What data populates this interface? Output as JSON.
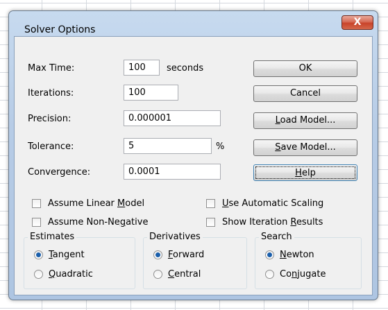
{
  "window": {
    "title": "Solver Options",
    "close_label": "X"
  },
  "fields": {
    "max_time": {
      "label": "Max Time:",
      "value": "100",
      "unit": "seconds"
    },
    "iterations": {
      "label": "Iterations:",
      "value": "100"
    },
    "precision": {
      "label": "Precision:",
      "value": "0.000001"
    },
    "tolerance": {
      "label": "Tolerance:",
      "value": "5",
      "unit": "%"
    },
    "convergence": {
      "label": "Convergence:",
      "value": "0.0001"
    }
  },
  "buttons": {
    "ok": "OK",
    "cancel": "Cancel",
    "load_model": {
      "mnemonic": "L",
      "rest": "oad Model..."
    },
    "save_model": {
      "mnemonic": "S",
      "rest": "ave Model..."
    },
    "help": {
      "mnemonic": "H",
      "rest": "elp"
    }
  },
  "checkboxes": {
    "linear_model": {
      "pre": "Assume Linear ",
      "mnemonic": "M",
      "post": "odel",
      "checked": false
    },
    "non_negative": {
      "pre": "Assume Non-Ne",
      "mnemonic": "g",
      "post": "ative",
      "checked": false
    },
    "auto_scaling": {
      "pre": "",
      "mnemonic": "U",
      "post": "se Automatic Scaling",
      "checked": false
    },
    "iteration_results": {
      "pre": "Show Iteration ",
      "mnemonic": "R",
      "post": "esults",
      "checked": false
    }
  },
  "groups": {
    "estimates": {
      "title": "Estimates",
      "options": [
        {
          "pre": "",
          "mnemonic": "T",
          "post": "angent",
          "selected": true
        },
        {
          "pre": "",
          "mnemonic": "Q",
          "post": "uadratic",
          "selected": false
        }
      ]
    },
    "derivatives": {
      "title": "Derivatives",
      "options": [
        {
          "pre": "",
          "mnemonic": "F",
          "post": "orward",
          "selected": true
        },
        {
          "pre": "",
          "mnemonic": "C",
          "post": "entral",
          "selected": false
        }
      ]
    },
    "search": {
      "title": "Search",
      "options": [
        {
          "pre": "",
          "mnemonic": "N",
          "post": "ewton",
          "selected": true
        },
        {
          "pre": "Co",
          "mnemonic": "n",
          "post": "jugate",
          "selected": false
        }
      ]
    }
  }
}
